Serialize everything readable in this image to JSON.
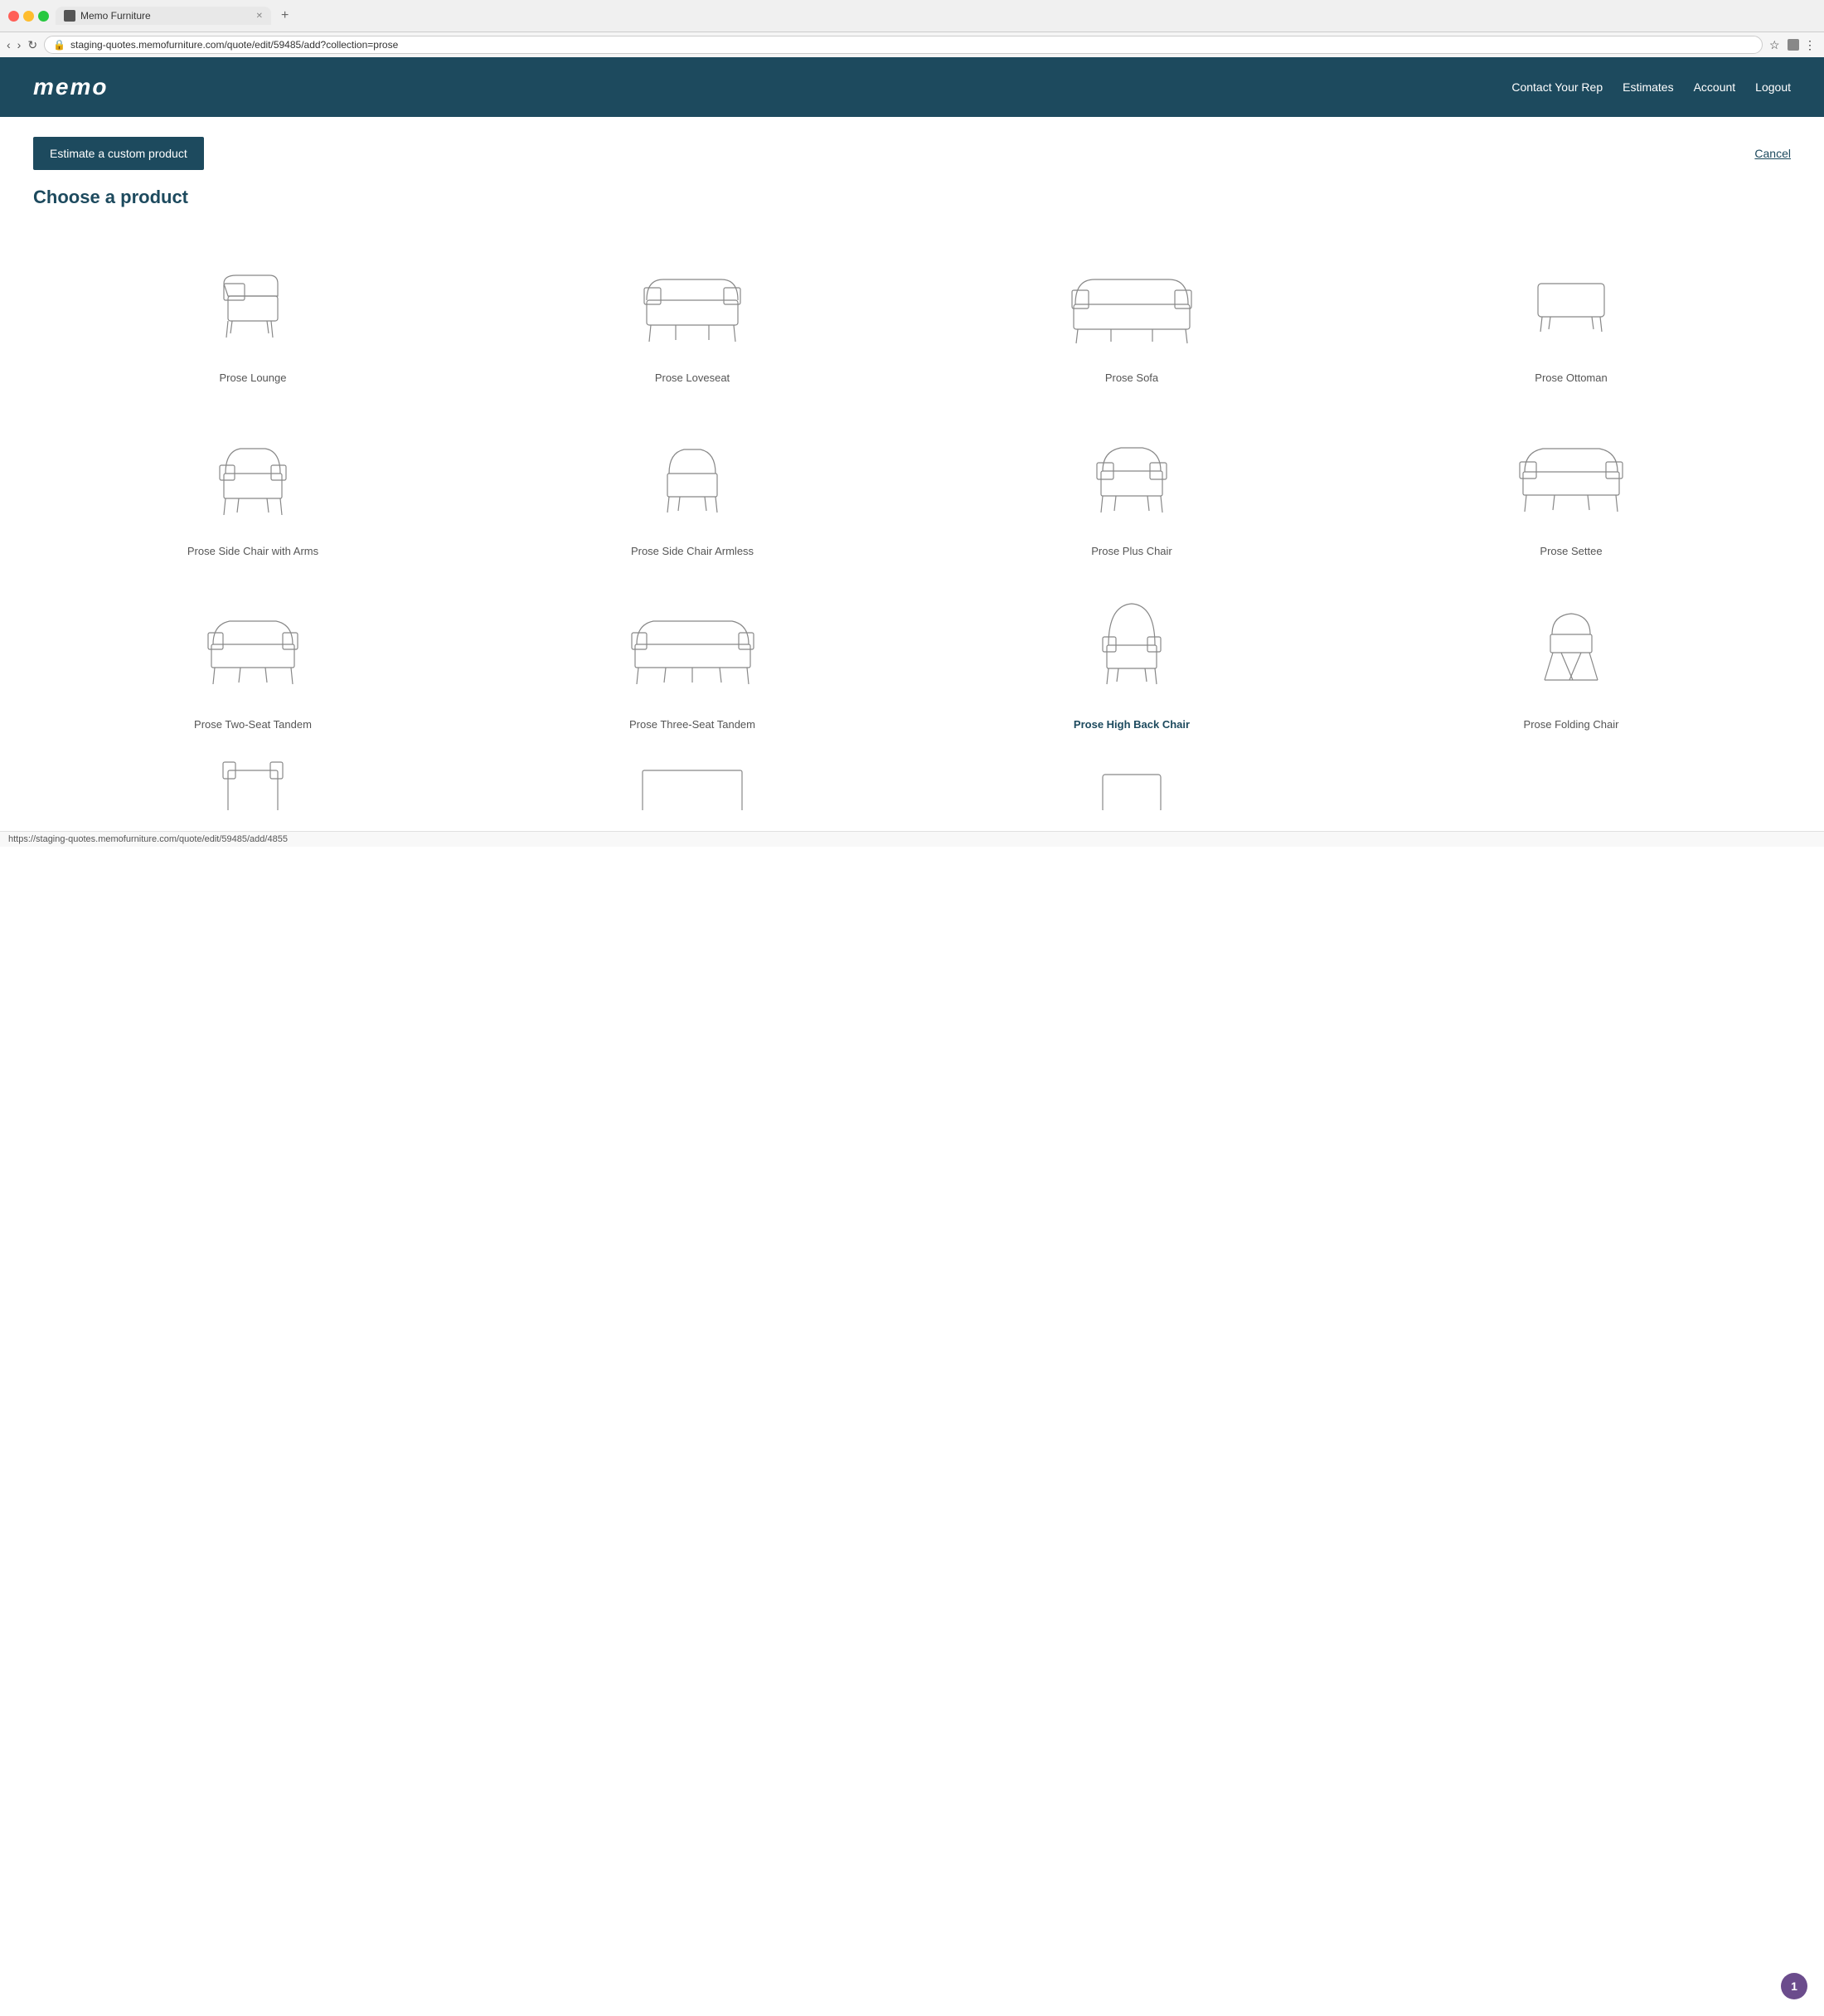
{
  "browser": {
    "tab_title": "Memo Furniture",
    "url": "staging-quotes.memofurniture.com/quote/edit/59485/add?collection=prose",
    "new_tab_label": "+"
  },
  "header": {
    "logo": "memo",
    "nav_items": [
      {
        "label": "Contact Your Rep",
        "id": "contact-rep"
      },
      {
        "label": "Estimates",
        "id": "estimates"
      },
      {
        "label": "Account",
        "id": "account"
      },
      {
        "label": "Logout",
        "id": "logout"
      }
    ]
  },
  "page": {
    "estimate_btn_label": "Estimate a custom product",
    "cancel_label": "Cancel",
    "title": "Choose a product",
    "products": [
      {
        "id": "prose-lounge",
        "name": "Prose Lounge",
        "active": false
      },
      {
        "id": "prose-loveseat",
        "name": "Prose Loveseat",
        "active": false
      },
      {
        "id": "prose-sofa",
        "name": "Prose Sofa",
        "active": false
      },
      {
        "id": "prose-ottoman",
        "name": "Prose Ottoman",
        "active": false
      },
      {
        "id": "prose-side-chair-arms",
        "name": "Prose Side Chair with Arms",
        "active": false
      },
      {
        "id": "prose-side-chair-armless",
        "name": "Prose Side Chair Armless",
        "active": false
      },
      {
        "id": "prose-plus-chair",
        "name": "Prose Plus Chair",
        "active": false
      },
      {
        "id": "prose-settee",
        "name": "Prose Settee",
        "active": false
      },
      {
        "id": "prose-two-seat",
        "name": "Prose Two-Seat Tandem",
        "active": false
      },
      {
        "id": "prose-three-seat",
        "name": "Prose Three-Seat Tandem",
        "active": false
      },
      {
        "id": "prose-high-back",
        "name": "Prose High Back Chair",
        "active": true
      },
      {
        "id": "prose-folding",
        "name": "Prose Folding Chair",
        "active": false
      },
      {
        "id": "prose-extra1",
        "name": "",
        "active": false
      },
      {
        "id": "prose-extra2",
        "name": "",
        "active": false
      },
      {
        "id": "prose-extra3",
        "name": "",
        "active": false
      }
    ]
  },
  "status_bar": {
    "url": "https://staging-quotes.memofurniture.com/quote/edit/59485/add/4855"
  },
  "badge": {
    "count": "1"
  }
}
